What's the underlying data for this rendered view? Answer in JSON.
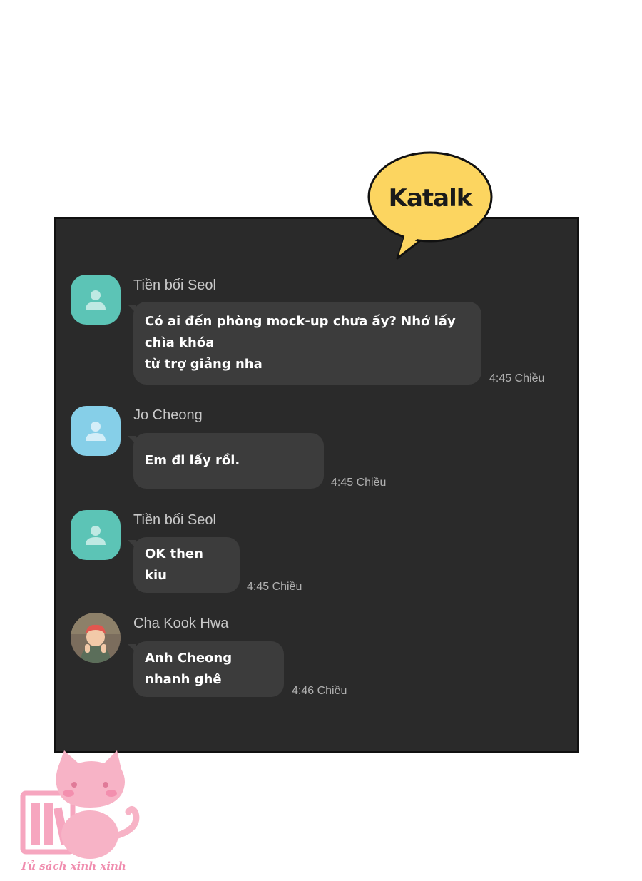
{
  "callout": {
    "label": "Katalk"
  },
  "messages": [
    {
      "sender": "Tiền bối Seol",
      "text_lines": [
        "Có ai đến phòng mock-up chưa ấy? Nhớ lấy chìa khóa",
        "từ trợ giảng nha"
      ],
      "time": "4:45 Chiều",
      "avatar": "person-icon-teal"
    },
    {
      "sender": "Jo Cheong",
      "text_lines": [
        "Em đi lấy rồi."
      ],
      "time": "4:45 Chiều",
      "avatar": "person-icon-blue"
    },
    {
      "sender": "Tiền bối Seol",
      "text_lines": [
        "OK then kiu"
      ],
      "time": "4:45 Chiều",
      "avatar": "person-icon-teal"
    },
    {
      "sender": "Cha Kook Hwa",
      "text_lines": [
        "Anh Cheong nhanh ghê"
      ],
      "time": "4:46 Chiều",
      "avatar": "photo-avatar"
    }
  ],
  "watermark": {
    "text": "Tủ sách xinh xinh"
  },
  "colors": {
    "panel": "#2a2a2a",
    "bubble": "#3c3c3c",
    "callout": "#fcd560",
    "teal": "#5cc4b6",
    "blue": "#86cfe8"
  }
}
